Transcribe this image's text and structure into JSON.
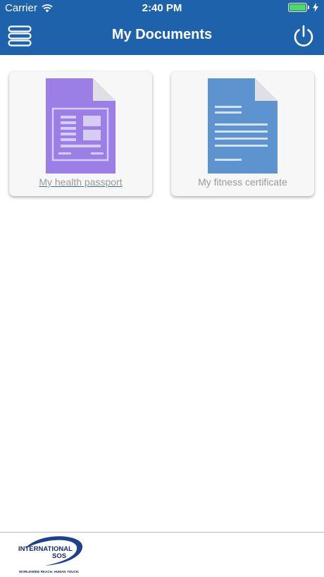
{
  "status_bar": {
    "carrier": "Carrier",
    "time": "2:40 PM",
    "battery_color": "#4cd964"
  },
  "nav": {
    "title": "My Documents",
    "left_icon": "menu-icon",
    "right_icon": "power-icon",
    "bar_color": "#1f62ac"
  },
  "documents": [
    {
      "label": "My health passport",
      "icon": "health-passport-document-icon",
      "color": "#9b7fe6"
    },
    {
      "label": "My fitness certificate",
      "icon": "fitness-certificate-document-icon",
      "color": "#5d93cf"
    }
  ],
  "footer": {
    "logo_line1": "INTERNATIONAL",
    "logo_line2": "SOS",
    "logo_tagline": "WORLDWIDE REACH. HUMAN TOUCH."
  }
}
